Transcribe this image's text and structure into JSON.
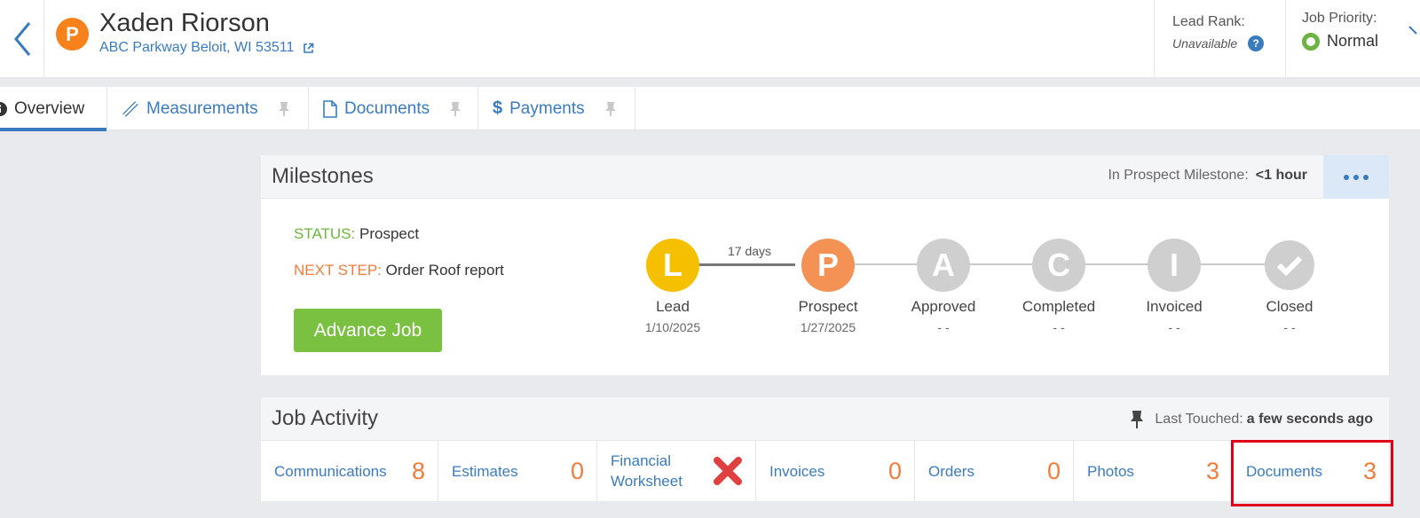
{
  "header": {
    "badge_letter": "P",
    "customer_name": "Xaden Riorson",
    "address": "ABC Parkway Beloit, WI 53511",
    "lead_rank_label": "Lead Rank:",
    "lead_rank_value": "Unavailable",
    "job_priority_label": "Job Priority:",
    "job_priority_value": "Normal"
  },
  "tabs": [
    {
      "label": "Overview",
      "icon": "info-icon"
    },
    {
      "label": "Measurements",
      "icon": "ruler-icon"
    },
    {
      "label": "Documents",
      "icon": "document-icon"
    },
    {
      "label": "Payments",
      "icon": "dollar-icon"
    }
  ],
  "milestones": {
    "title": "Milestones",
    "meta_label": "In Prospect Milestone:",
    "meta_value": "<1 hour",
    "status_key": "STATUS:",
    "status_value": "Prospect",
    "next_step_key": "NEXT STEP:",
    "next_step_value": "Order Roof report",
    "advance_label": "Advance Job",
    "gap_label": "17 days",
    "steps": [
      {
        "letter": "L",
        "label": "Lead",
        "date": "1/10/2025"
      },
      {
        "letter": "P",
        "label": "Prospect",
        "date": "1/27/2025"
      },
      {
        "letter": "A",
        "label": "Approved",
        "date": "- -"
      },
      {
        "letter": "C",
        "label": "Completed",
        "date": "- -"
      },
      {
        "letter": "I",
        "label": "Invoiced",
        "date": "- -"
      },
      {
        "letter": "✔",
        "label": "Closed",
        "date": "- -"
      }
    ]
  },
  "job_activity": {
    "title": "Job Activity",
    "last_touched_label": "Last Touched:",
    "last_touched_value": "a few seconds ago",
    "items": [
      {
        "name": "Communications",
        "count": "8"
      },
      {
        "name": "Estimates",
        "count": "0"
      },
      {
        "name": "Financial Worksheet",
        "count": ""
      },
      {
        "name": "Invoices",
        "count": "0"
      },
      {
        "name": "Orders",
        "count": "0"
      },
      {
        "name": "Photos",
        "count": "3"
      },
      {
        "name": "Documents",
        "count": "3"
      }
    ]
  },
  "colors": {
    "accent": "#3a7bbf",
    "lead": "#f5c000",
    "prospect": "#f39254",
    "inactive": "#cfcfcf",
    "highlight": "#e0001a"
  }
}
